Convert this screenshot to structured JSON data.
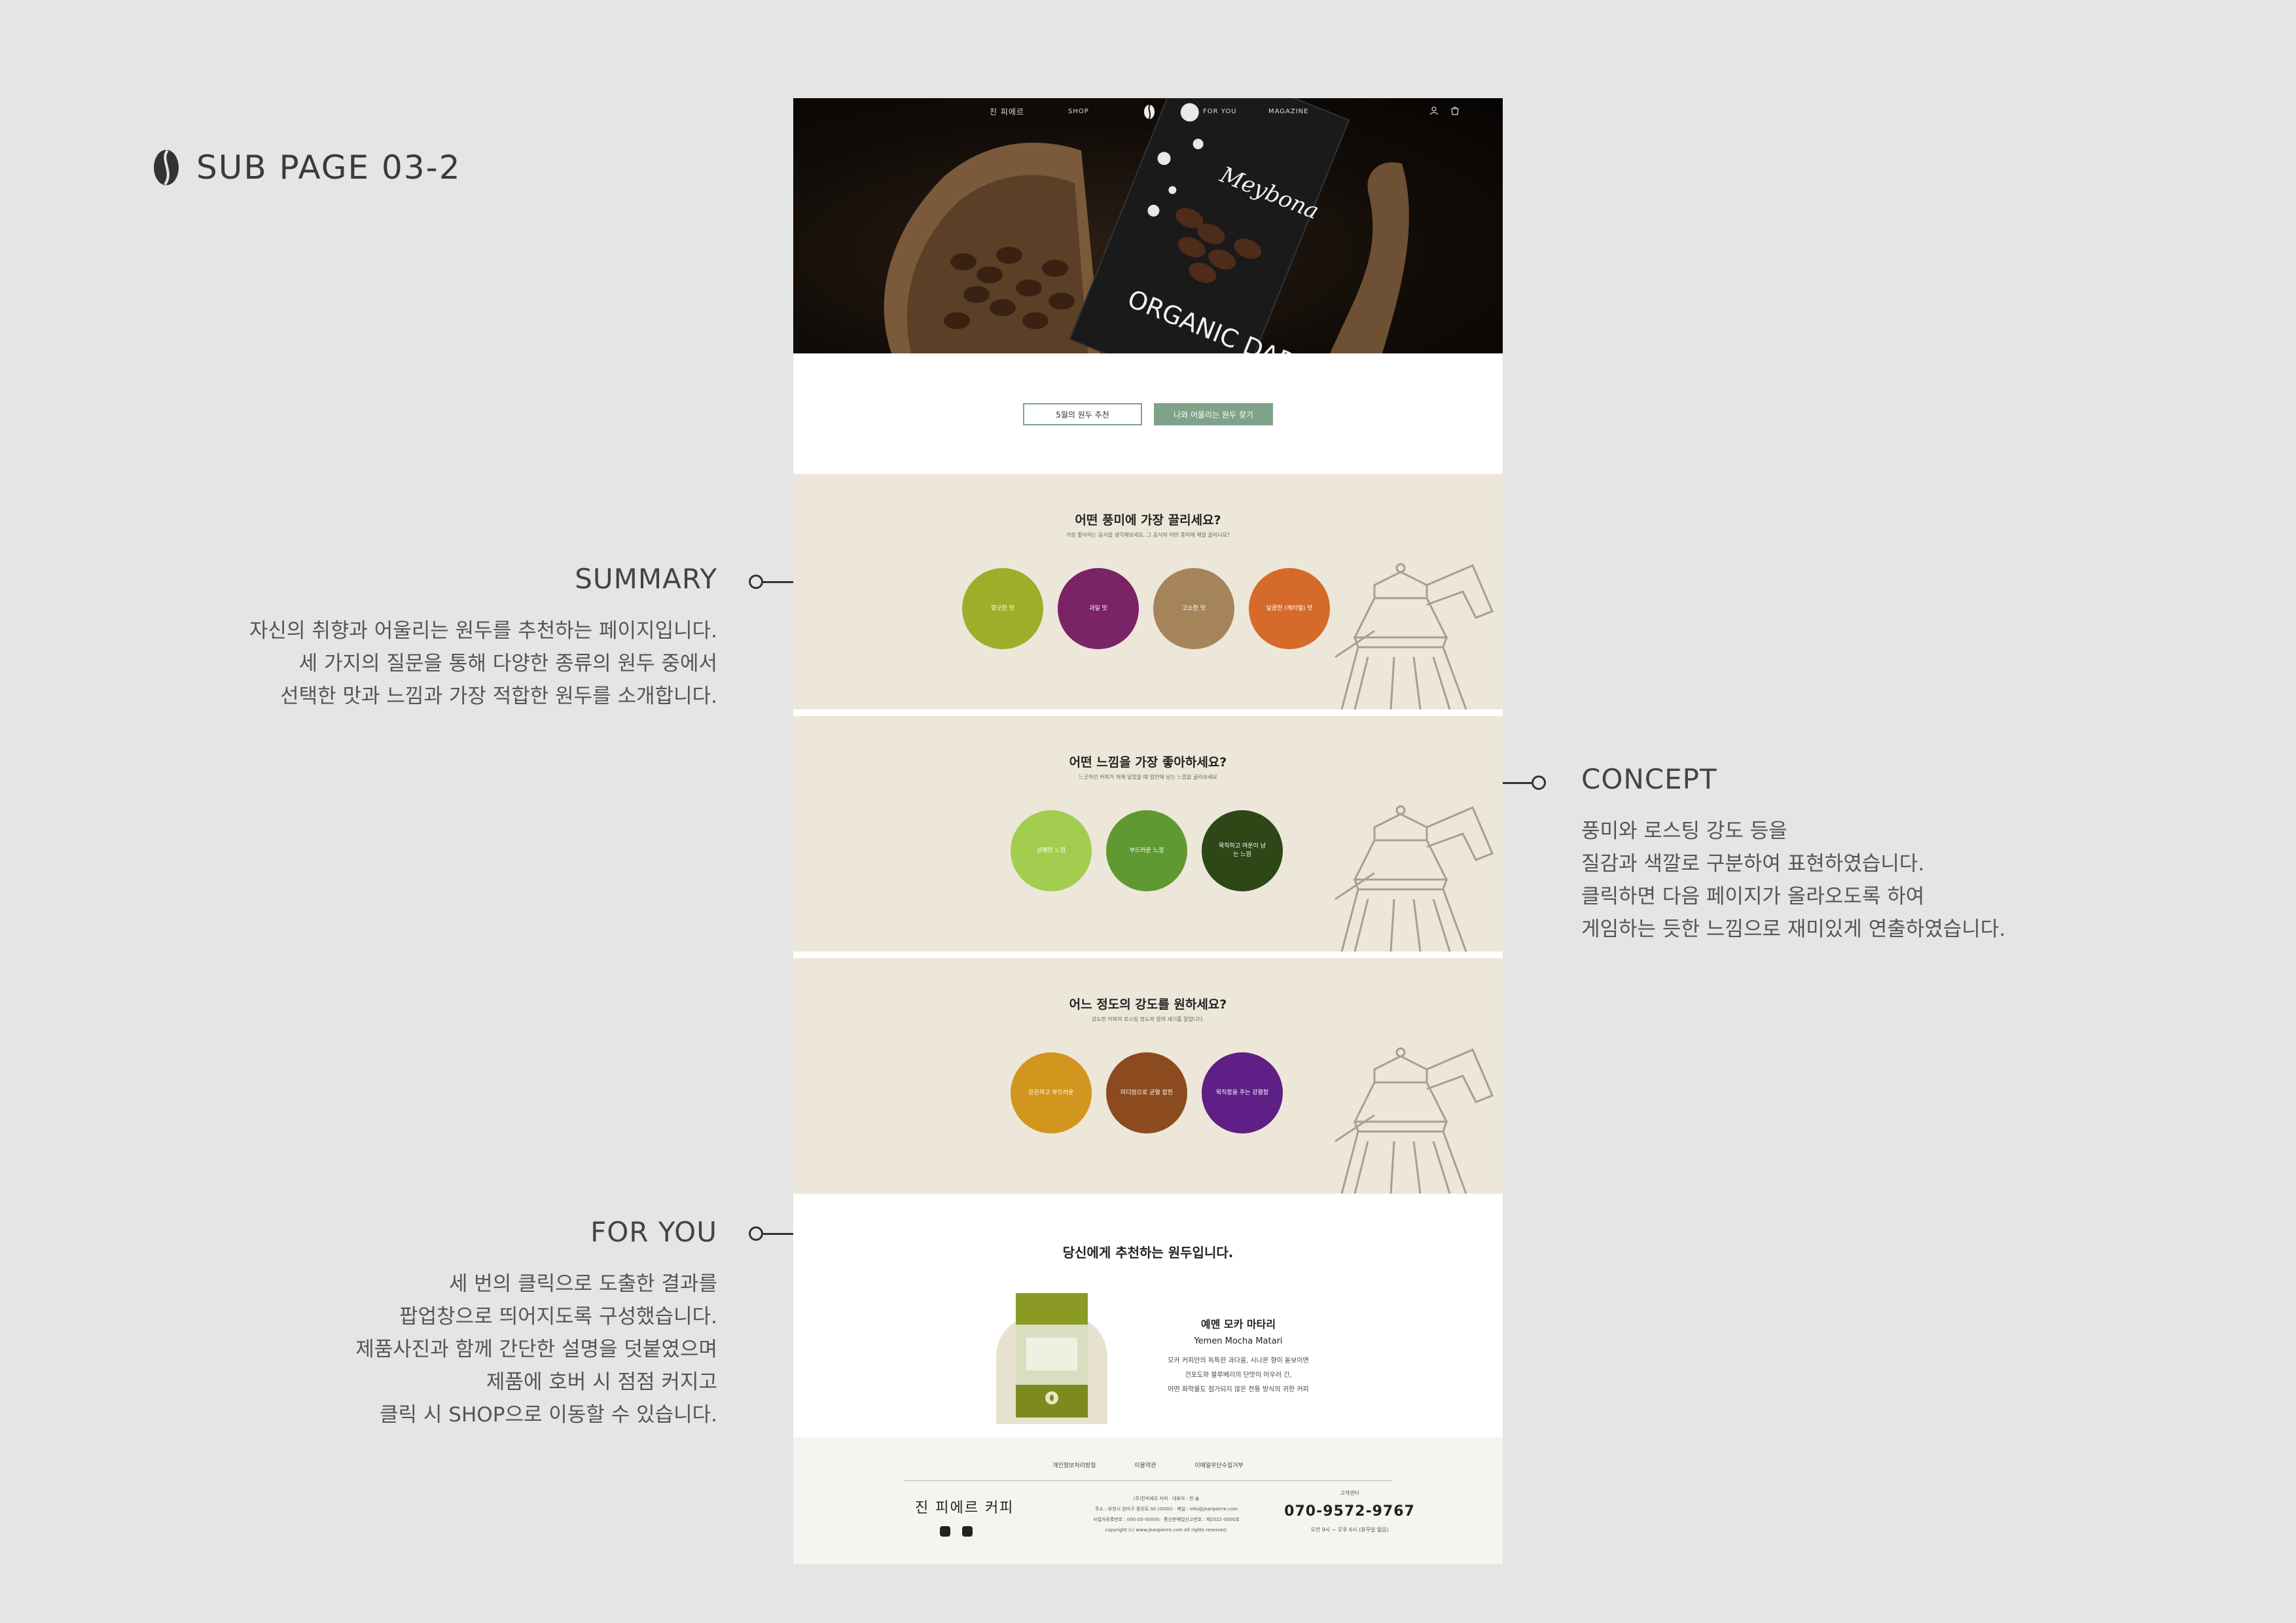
{
  "page_label": "SUB PAGE 03-2",
  "annotations": {
    "summary": {
      "title": "SUMMARY",
      "lines": [
        "자신의 취향과 어울리는 원두를 추천하는 페이지입니다.",
        "세 가지의 질문을 통해 다양한 종류의 원두 중에서",
        "선택한 맛과 느낌과 가장 적합한 원두를 소개합니다."
      ]
    },
    "concept": {
      "title": "CONCEPT",
      "lines": [
        "풍미와 로스팅 강도 등을",
        "질감과 색깔로 구분하여 표현하였습니다.",
        "클릭하면 다음 페이지가 올라오도록 하여",
        "게임하는 듯한 느낌으로 재미있게 연출하였습니다."
      ]
    },
    "for_you": {
      "title": "FOR YOU",
      "lines": [
        "세 번의 클릭으로 도출한 결과를",
        "팝업창으로 띄어지도록 구성했습니다.",
        "제품사진과 함께 간단한 설명을 덧붙였으며",
        "제품에 호버 시 점점 커지고",
        "클릭 시 SHOP으로 이동할 수 있습니다."
      ]
    }
  },
  "nav": {
    "brand": "진 피에르",
    "items": [
      "SHOP",
      "FOR YOU",
      "MAGAZINE"
    ]
  },
  "hero": {
    "bag_brand": "Meybona",
    "bag_text": "ORGANIC DARK"
  },
  "tabs": {
    "monthly": "5월의 원두 추천",
    "find": "나와 어울리는 원두 찾기"
  },
  "questions": [
    {
      "title": "어떤 풍미에 가장 끌리세요?",
      "subtitle": "가장 좋아하는 음식을 생각해보세요. 그 음식의 어떤 풍미에 제일 끌리나요?",
      "options": [
        {
          "label": "향긋한 맛",
          "color": "#9fae2a"
        },
        {
          "label": "과일 맛",
          "color": "#7a2367"
        },
        {
          "label": "고소한 맛",
          "color": "#a6845a"
        },
        {
          "label": "달콤한 (캐러멜) 맛",
          "color": "#d66a2a"
        }
      ]
    },
    {
      "title": "어떤 느낌을 가장 좋아하세요?",
      "subtitle": "느긋하던 커피가 혀에 닿았을 때 입안에 남는 느낌을 골라보세요",
      "options": [
        {
          "label": "상쾌한 느낌",
          "color": "#a3cd4f"
        },
        {
          "label": "부드러운 느낌",
          "color": "#5e9a31"
        },
        {
          "label": "묵직하고 여운이 남는 느낌",
          "color": "#2d4716"
        }
      ]
    },
    {
      "title": "어느 정도의 강도를 원하세요?",
      "subtitle": "강도란 커피의 로스팅 정도와 향의 세기를 말합니다.",
      "options": [
        {
          "label": "은은하고 부드러운",
          "color": "#d2951d"
        },
        {
          "label": "미디엄으로 균형 잡힌",
          "color": "#8c4b1e"
        },
        {
          "label": "묵직함을 주는 강렬함",
          "color": "#5e1f86"
        }
      ]
    }
  ],
  "result": {
    "title": "당신에게 추천하는 원두입니다.",
    "name_ko": "예멘 모카 마타리",
    "name_en": "Yemen Mocha Matari",
    "desc": [
      "모카 커피만의 독특한 과다움, 시나몬 향이 돋보이면",
      "건포도와 블루베리의 단맛이 어우러 긴,",
      "어떤 화학물도 첨가되지 않은 전통 방식의 귀한 커피"
    ]
  },
  "footer": {
    "links": [
      "개인정보처리방침",
      "이용약관",
      "이메일무단수집거부"
    ],
    "logo": "진 피에르 커피",
    "info": [
      "(주)진피에르 커피 · 대표자 : 한 솔",
      "주소 : 부천시 원미구 중앙로 00 (0000) · 메일 : info@jeanpierre.com",
      "사업자등록번호 : 000-00-00000 · 통신판매업신고번호 : 제2022-0000호",
      "copyright (c) www.jeanpierre.com All rights reserved."
    ],
    "cs_label": "고객센터",
    "phone": "070-9572-9767",
    "hours": "오전 9시 ~ 오후 6시 (휴무일 없음)"
  }
}
